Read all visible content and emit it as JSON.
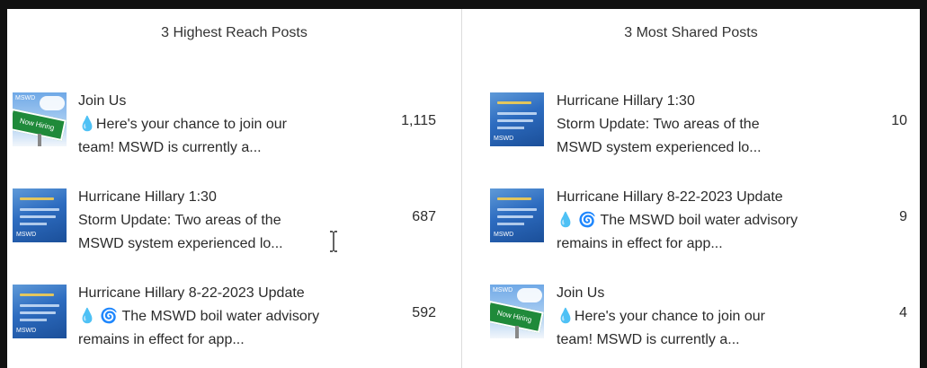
{
  "left_panel": {
    "title": "3 Highest Reach Posts",
    "posts": [
      {
        "thumb_icon": "now-hiring-thumbnail",
        "thumb_sign_text": "Now Hiring",
        "title": "Join Us",
        "line2_icon": "droplet-icon",
        "line2": "Here's your chance to join our",
        "line3": "team! MSWD is currently a...",
        "value": "1,115"
      },
      {
        "thumb_icon": "storm-update-thumbnail",
        "title": "Hurricane Hillary 1:30",
        "line2": "Storm Update: Two areas of the",
        "line3": "MSWD system experienced lo...",
        "value": "687"
      },
      {
        "thumb_icon": "storm-update-thumbnail",
        "title": "Hurricane Hillary 8-22-2023 Update",
        "line2_icons": [
          "droplet-icon",
          "cyclone-icon"
        ],
        "line2": "The MSWD boil water advisory",
        "line3": "remains in effect for app...",
        "value": "592"
      }
    ]
  },
  "right_panel": {
    "title": "3 Most Shared Posts",
    "posts": [
      {
        "thumb_icon": "storm-update-thumbnail",
        "title": "Hurricane Hillary 1:30",
        "line2": "Storm Update: Two areas of the",
        "line3": "MSWD system experienced lo...",
        "value": "10"
      },
      {
        "thumb_icon": "storm-update-thumbnail",
        "title": "Hurricane Hillary 8-22-2023 Update",
        "line2_icons": [
          "droplet-icon",
          "cyclone-icon"
        ],
        "line2": "The MSWD boil water advisory",
        "line3": "remains in effect for app...",
        "value": "9"
      },
      {
        "thumb_icon": "now-hiring-thumbnail",
        "thumb_sign_text": "Now Hiring",
        "title": "Join Us",
        "line2_icon": "droplet-icon",
        "line2": "Here's your chance to join our",
        "line3": "team! MSWD is currently a...",
        "value": "4"
      }
    ]
  },
  "colors": {
    "frame": "#111111",
    "divider": "#dcdcdc",
    "text": "#2b2b2b",
    "emoji_blue": "#2f8ce0"
  },
  "cursor": "text-ibeam-cursor"
}
